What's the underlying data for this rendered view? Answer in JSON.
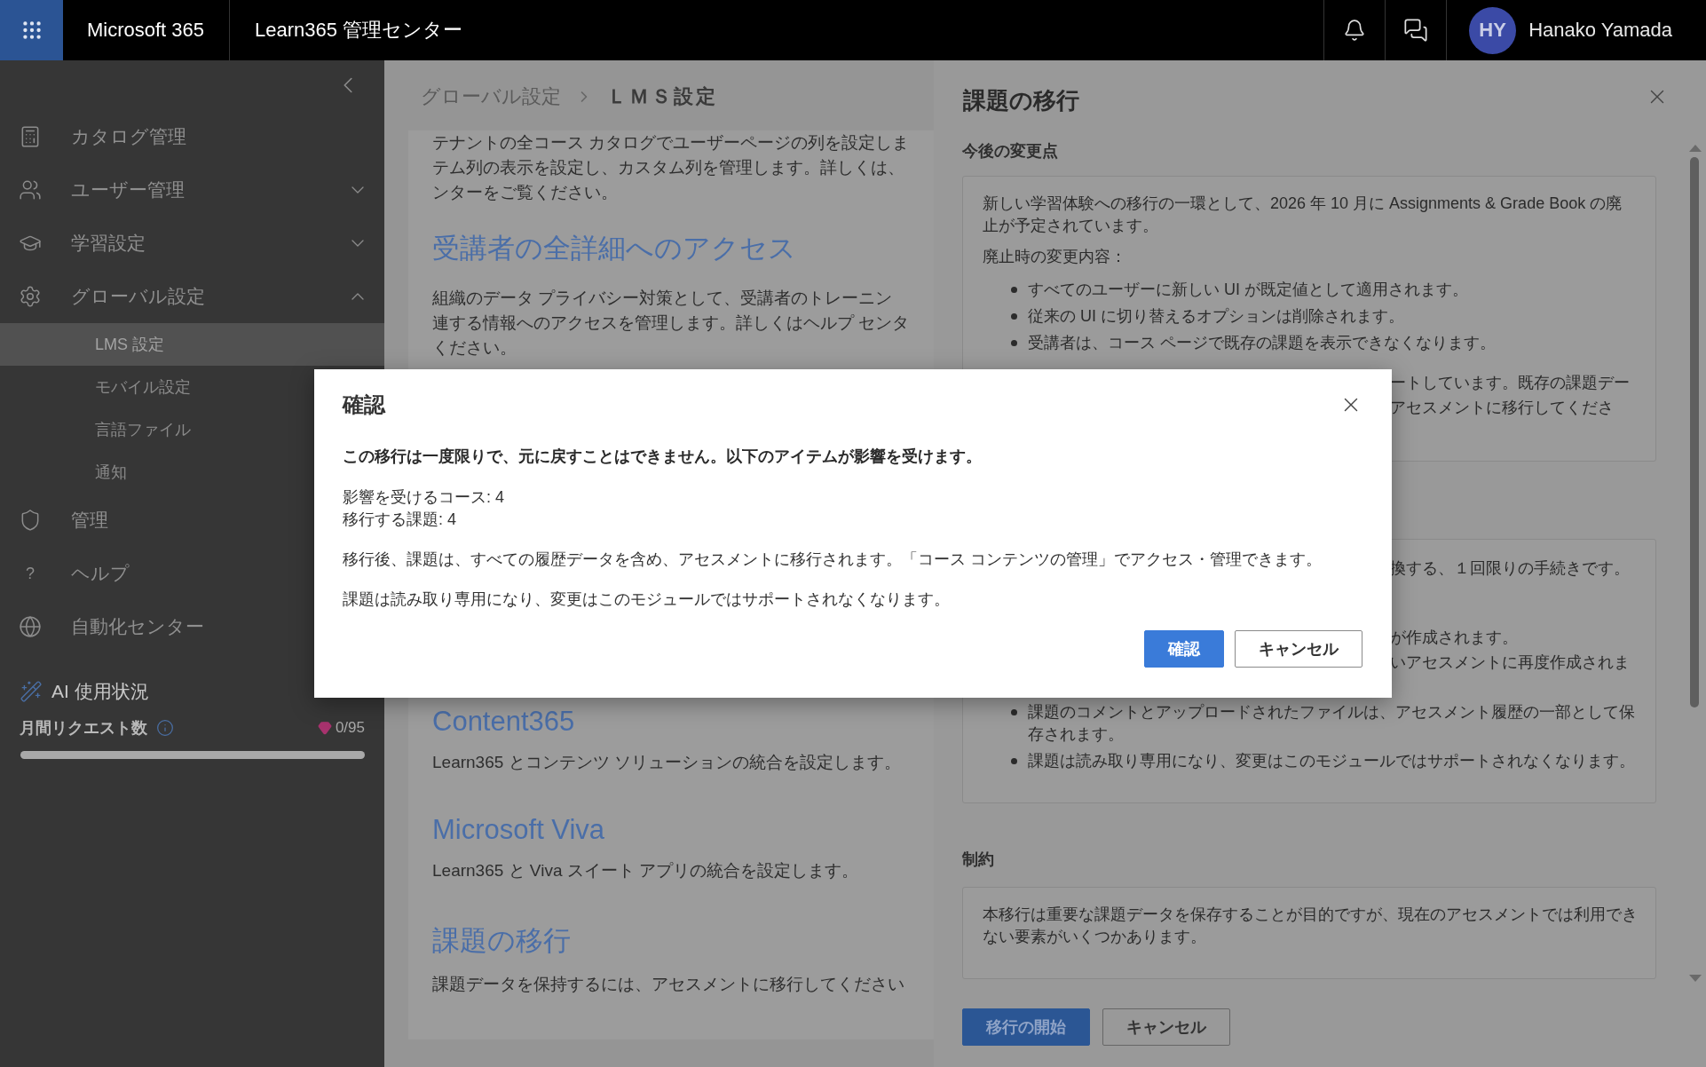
{
  "top_bar": {
    "suite": "Microsoft 365",
    "app": "Learn365 管理センター",
    "user": {
      "initials": "HY",
      "name": "Hanako Yamada"
    }
  },
  "sidebar": {
    "items": [
      {
        "label": "カタログ管理"
      },
      {
        "label": "ユーザー管理",
        "expanded": false
      },
      {
        "label": "学習設定",
        "expanded": false
      },
      {
        "label": "グローバル設定",
        "expanded": true,
        "children": [
          {
            "label": "LMS 設定",
            "selected": true
          },
          {
            "label": "モバイル設定",
            "selected": false
          },
          {
            "label": "言語ファイル",
            "selected": false
          },
          {
            "label": "通知",
            "selected": false
          }
        ]
      },
      {
        "label": "管理"
      },
      {
        "label": "ヘルプ",
        "glyph": "?"
      },
      {
        "label": "自動化センター"
      }
    ],
    "usage": {
      "title": "AI 使用状況",
      "label": "月間リクエスト数",
      "count": "0/95",
      "level": 0
    }
  },
  "main": {
    "breadcrumb": [
      {
        "label": "グローバル設定",
        "current": false
      },
      {
        "label": "ＬＭＳ設定",
        "current": true
      }
    ],
    "upper_sections": [
      {
        "lines": [
          "テナントの全コース カタログでユーザーページの列を設定しま",
          "テム列の表示を設定し、カスタム列を管理します。詳しくは、",
          "ンターをご覧ください。"
        ]
      },
      {
        "heading": "受講者の全詳細へのアクセス",
        "lines": [
          "組織のデータ プライバシー対策として、受講者のトレーニン",
          "連する情報へのアクセスを管理します。詳しくはヘルプ センタ",
          "ください。"
        ]
      }
    ],
    "lower_sections": [
      {
        "heading": "Content365",
        "lines": [
          "Learn365 とコンテンツ ソリューションの統合を設定します。"
        ]
      },
      {
        "heading": "Microsoft Viva",
        "lines": [
          "Learn365 と Viva スイート アプリの統合を設定します。"
        ]
      },
      {
        "heading": "課題の移行",
        "lines": [
          "課題データを保持するには、アセスメントに移行してください"
        ]
      }
    ]
  },
  "panel": {
    "title": "課題の移行",
    "sections": [
      {
        "heading": "今後の変更点",
        "blocks": [
          {
            "kind": "paragraph",
            "text": "新しい学習体験への移行の一環として、2026 年 10 月に Assignments & Grade Book の廃止が予定されています。"
          },
          {
            "kind": "paragraph",
            "text": "廃止時の変更内容："
          },
          {
            "kind": "bullets",
            "items": [
              "すべてのユーザーに新しい UI が既定値として適用されます。",
              "従来の UI に切り替えるオプションは削除されます。",
              "受講者は、コース ページで既存の課題を表示できなくなります。"
            ]
          },
          {
            "kind": "fragment",
            "lines": [
              "ートしています。既存の課題デー",
              "アセスメントに移行してくださ"
            ]
          }
        ]
      },
      {
        "blocks": [
          {
            "kind": "fragment",
            "lines": [
              "換する、１回限りの手続きです。"
            ]
          },
          {
            "kind": "fragment",
            "lines": [
              "が作成されます。",
              "いアセスメントに再度作成されま"
            ]
          },
          {
            "kind": "bullets",
            "items": [
              "課題のコメントとアップロードされたファイルは、アセスメント履歴の一部として保存されます。",
              "課題は読み取り専用になり、変更はこのモジュールではサポートされなくなります。"
            ]
          }
        ]
      },
      {
        "heading": "制約",
        "blocks": [
          {
            "kind": "paragraph",
            "text": "本移行は重要な課題データを保存することが目的ですが、現在のアセスメントでは利用できない要素がいくつかあります。"
          }
        ]
      }
    ],
    "buttons": [
      {
        "label": "移行の開始",
        "kind": "primary"
      },
      {
        "label": "キャンセル",
        "kind": "secondary"
      }
    ]
  },
  "dialog": {
    "title": "確認",
    "warning": "この移行は一度限りで、元に戻すことはできません。以下のアイテムが影響を受けます。",
    "counts": [
      "影響を受けるコース: 4",
      "移行する課題: 4"
    ],
    "paragraphs": [
      "移行後、課題は、すべての履歴データを含め、アセスメントに移行されます。「コース コンテンツの管理」でアクセス・管理できます。",
      "課題は読み取り専用になり、変更はこのモジュールではサポートされなくなります。"
    ],
    "buttons": [
      {
        "label": "確認",
        "kind": "primary"
      },
      {
        "label": "キャンセル",
        "kind": "secondary"
      }
    ]
  }
}
